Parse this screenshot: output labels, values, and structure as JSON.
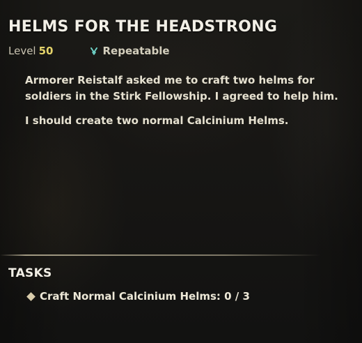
{
  "quest": {
    "title": "HELMS FOR THE HEADSTRONG",
    "level_label": "Level",
    "level_value": "50",
    "repeatable_icon": "repeat-chevron-icon",
    "repeatable_label": "Repeatable",
    "description": [
      "Armorer Reistalf asked me to craft two helms for soldiers in the Stirk Fellowship. I agreed to help him.",
      "I should create two normal Calcinium Helms."
    ]
  },
  "tasks": {
    "heading": "TASKS",
    "items": [
      {
        "label": "Craft Normal Calcinium Helms: 0 / 3",
        "bullet_icon": "diamond-bullet-icon"
      }
    ]
  },
  "colors": {
    "level_value": "#e4d36a",
    "repeatable_icon": "#6fd3c8",
    "text": "#e9e4d4"
  }
}
